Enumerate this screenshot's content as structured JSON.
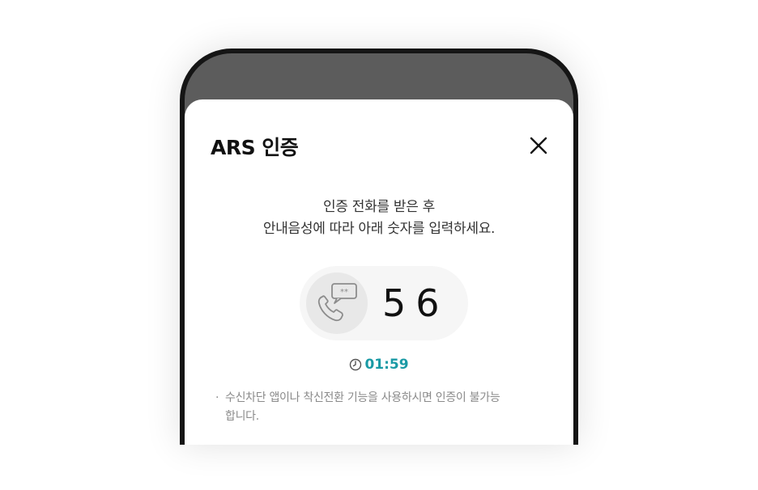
{
  "dialog": {
    "title": "ARS 인증",
    "guide_line1": "인증 전화를 받은 후",
    "guide_line2": "안내음성에 따라 아래 숫자를 입력하세요.",
    "code": "56",
    "timer": "01:59",
    "notice_bullet": "·",
    "notice": "수신차단 앱이나 착신전환 기능을 사용하시면 인증이 불가능합니다."
  },
  "icons": {
    "close": "close-icon",
    "phone": "phone-call-icon",
    "clock": "clock-icon"
  },
  "colors": {
    "accent": "#1a9aa5",
    "overlay": "#5c5c5c",
    "frame": "#151515"
  }
}
